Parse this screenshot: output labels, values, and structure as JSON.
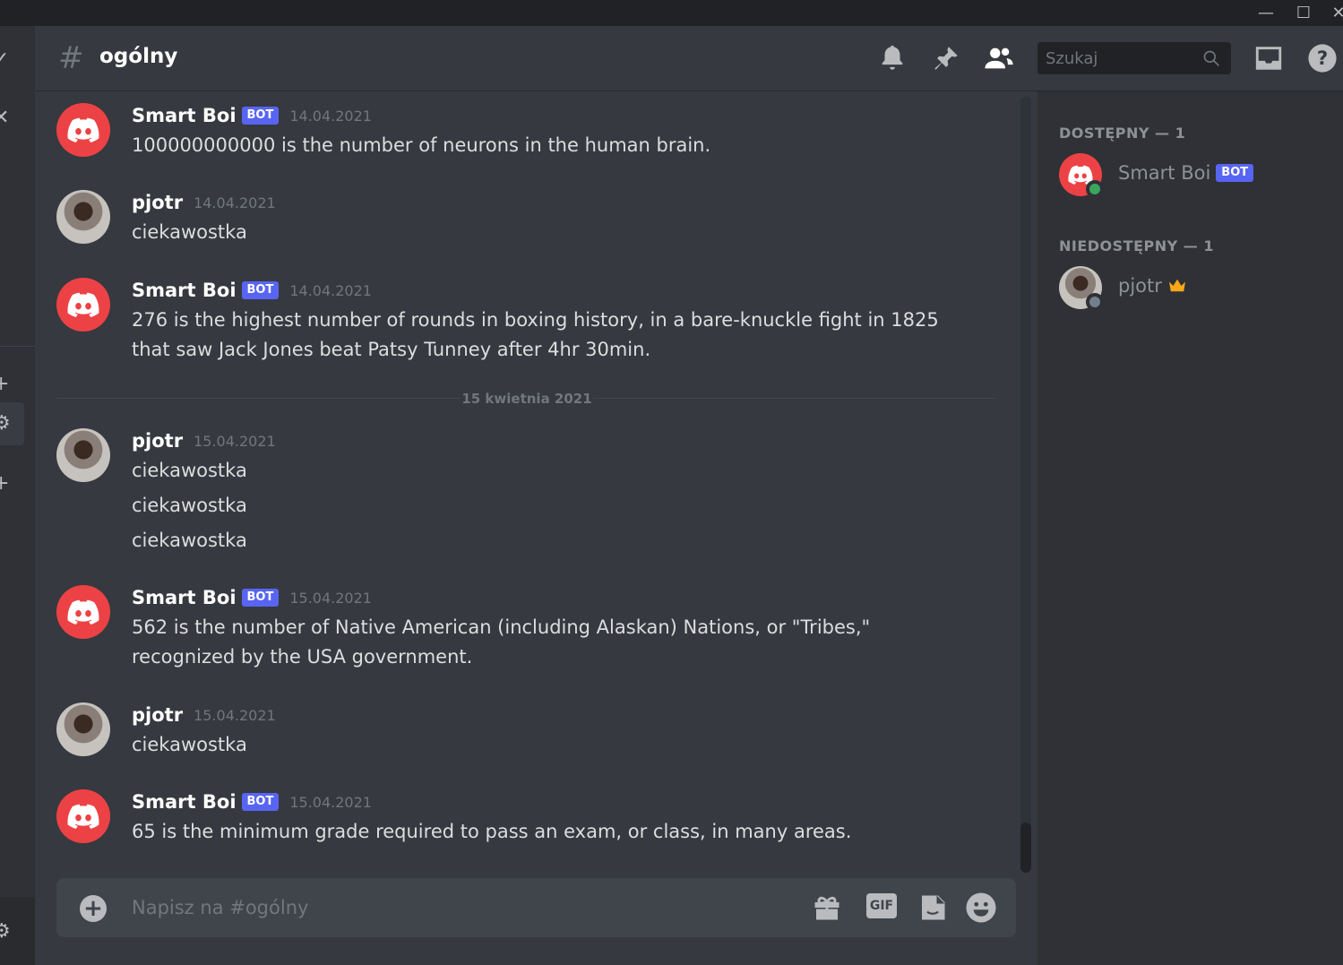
{
  "window": {
    "minimize_label": "—",
    "maximize_label": "☐",
    "close_label": "✕"
  },
  "header": {
    "channel_hash": "#",
    "channel_name": "ogólny",
    "search_placeholder": "Szukaj"
  },
  "messages": [
    {
      "author": "Smart Boi",
      "bot": true,
      "badge": "BOT",
      "timestamp": "14.04.2021",
      "lines": [
        "100000000000 is the number of neurons in the human brain."
      ]
    },
    {
      "author": "pjotr",
      "bot": false,
      "timestamp": "14.04.2021",
      "lines": [
        "ciekawostka"
      ]
    },
    {
      "author": "Smart Boi",
      "bot": true,
      "badge": "BOT",
      "timestamp": "14.04.2021",
      "lines": [
        "276 is the highest number of rounds in boxing history, in a bare-knuckle fight in 1825 that saw Jack Jones beat Patsy Tunney after 4hr 30min."
      ]
    },
    {
      "author": "pjotr",
      "bot": false,
      "timestamp": "15.04.2021",
      "lines": [
        "ciekawostka",
        "ciekawostka",
        "ciekawostka"
      ]
    },
    {
      "author": "Smart Boi",
      "bot": true,
      "badge": "BOT",
      "timestamp": "15.04.2021",
      "lines": [
        "562 is the number of Native American (including Alaskan) Nations, or \"Tribes,\" recognized by the USA government."
      ]
    },
    {
      "author": "pjotr",
      "bot": false,
      "timestamp": "15.04.2021",
      "lines": [
        "ciekawostka"
      ]
    },
    {
      "author": "Smart Boi",
      "bot": true,
      "badge": "BOT",
      "timestamp": "15.04.2021",
      "lines": [
        "65 is the minimum grade required to pass an exam, or class, in many areas."
      ]
    }
  ],
  "date_divider": "15 kwietnia 2021",
  "composer": {
    "placeholder": "Napisz na #ogólny",
    "gif_label": "GIF"
  },
  "members": {
    "online_title": "DOSTĘPNY — 1",
    "offline_title": "NIEDOSTĘPNY — 1",
    "online": [
      {
        "name": "Smart Boi",
        "badge": "BOT",
        "status_color": "#3ba55d"
      }
    ],
    "offline": [
      {
        "name": "pjotr",
        "owner_crown": true,
        "status_color": "#747f8d"
      }
    ]
  },
  "colors": {
    "accent": "#5865f2",
    "bot_avatar": "#ed4245",
    "online": "#3ba55d",
    "crown": "#faa81a"
  }
}
